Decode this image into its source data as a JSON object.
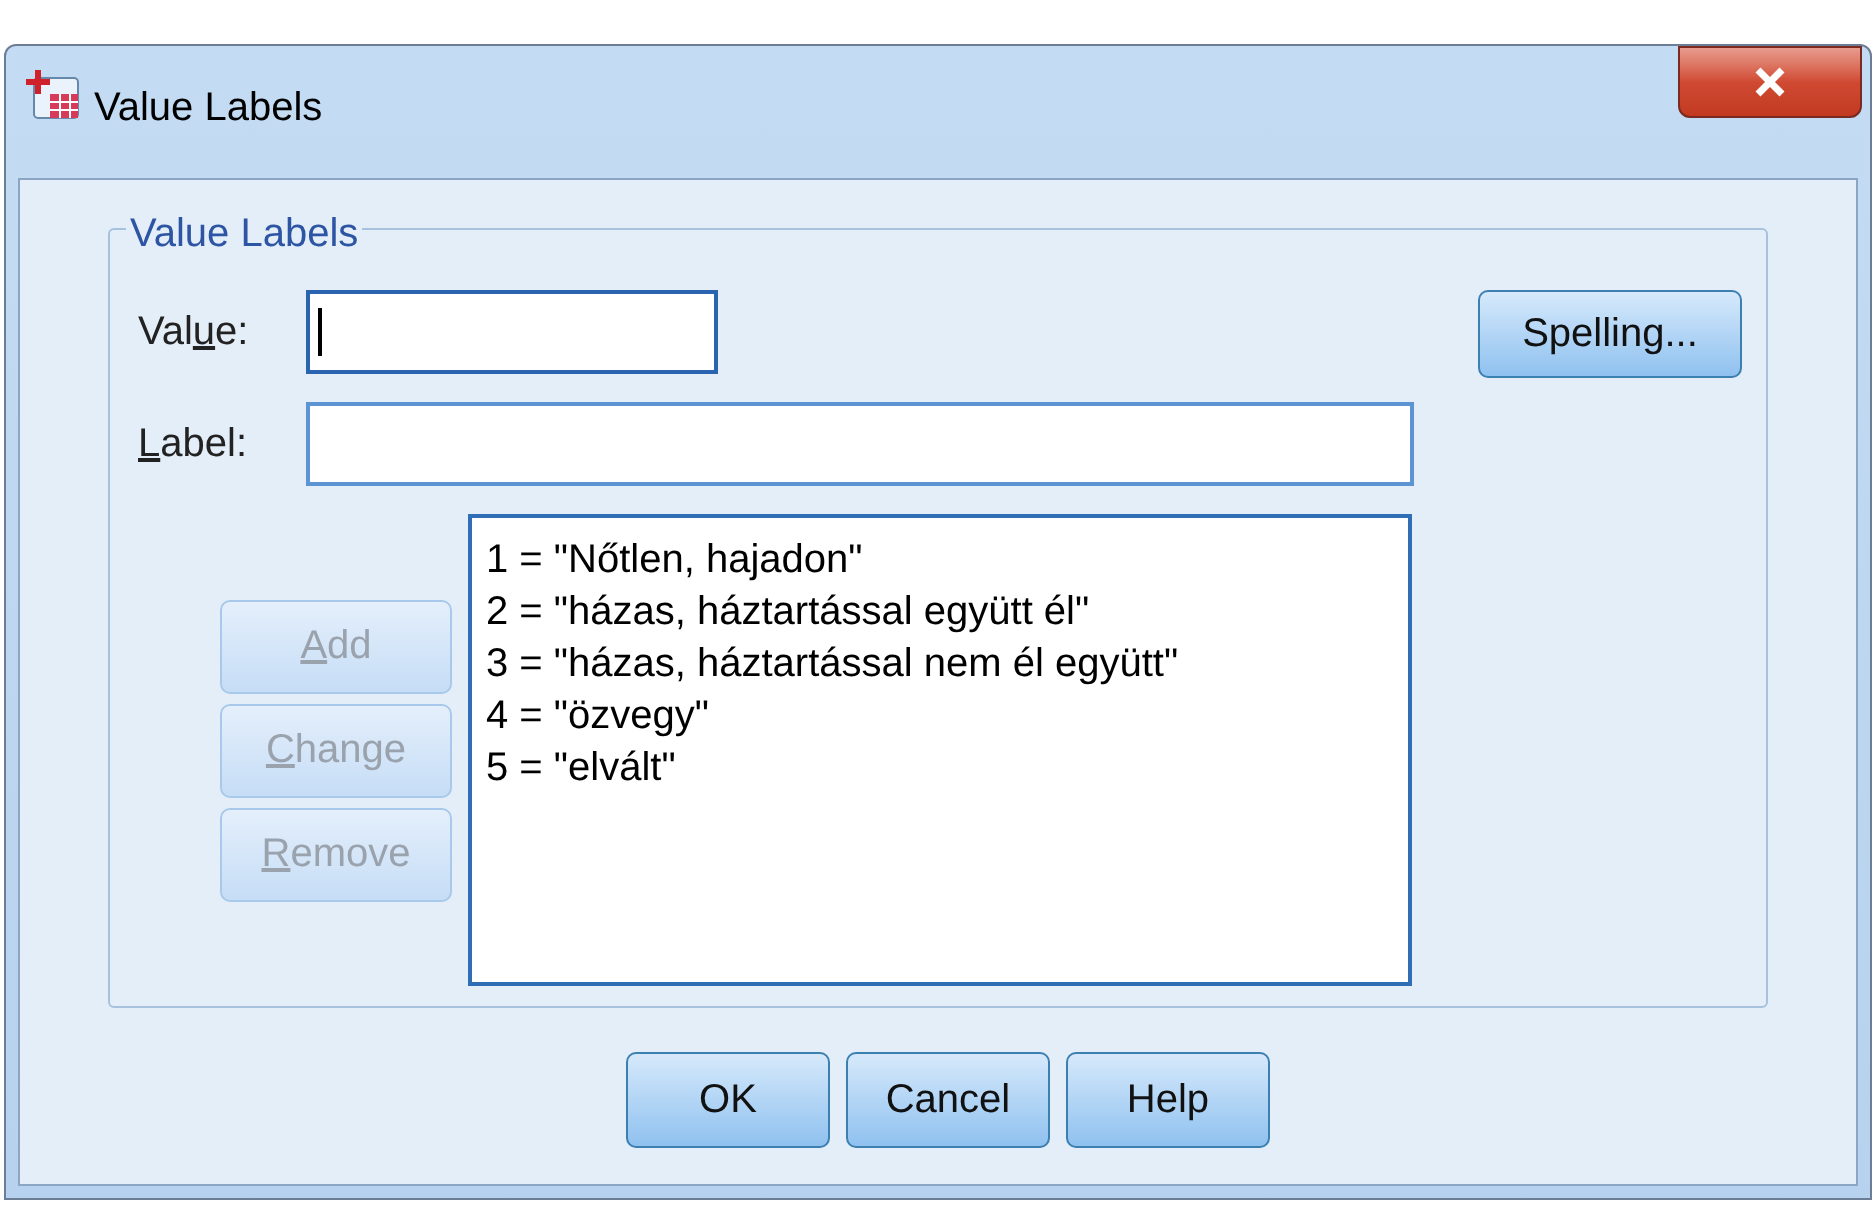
{
  "window": {
    "title": "Value Labels"
  },
  "group": {
    "title": "Value Labels"
  },
  "fields": [
    {
      "label": {
        "before": "Val",
        "key": "u",
        "after": "e:"
      },
      "focused": true
    },
    {
      "label": {
        "key": "L",
        "after": "abel:"
      },
      "focused": false
    }
  ],
  "spelling_button": {
    "label": "Spelling...",
    "disabled": false
  },
  "side_buttons": [
    {
      "label": {
        "key": "A",
        "after": "dd"
      },
      "disabled": true
    },
    {
      "label": {
        "key": "C",
        "after": "hange"
      },
      "disabled": true
    },
    {
      "label": {
        "key": "R",
        "after": "emove"
      },
      "disabled": true
    }
  ],
  "labels_list": [
    "1 = \"Nőtlen, hajadon\"",
    "2 = \"házas, háztartással együtt él\"",
    "3 = \"házas, háztartással nem él együtt\"",
    "4 = \"özvegy\"",
    "5 = \"elvált\""
  ],
  "footer_buttons": [
    {
      "label": "OK",
      "disabled": false
    },
    {
      "label": "Cancel",
      "disabled": false
    },
    {
      "label": "Help",
      "disabled": false
    }
  ]
}
